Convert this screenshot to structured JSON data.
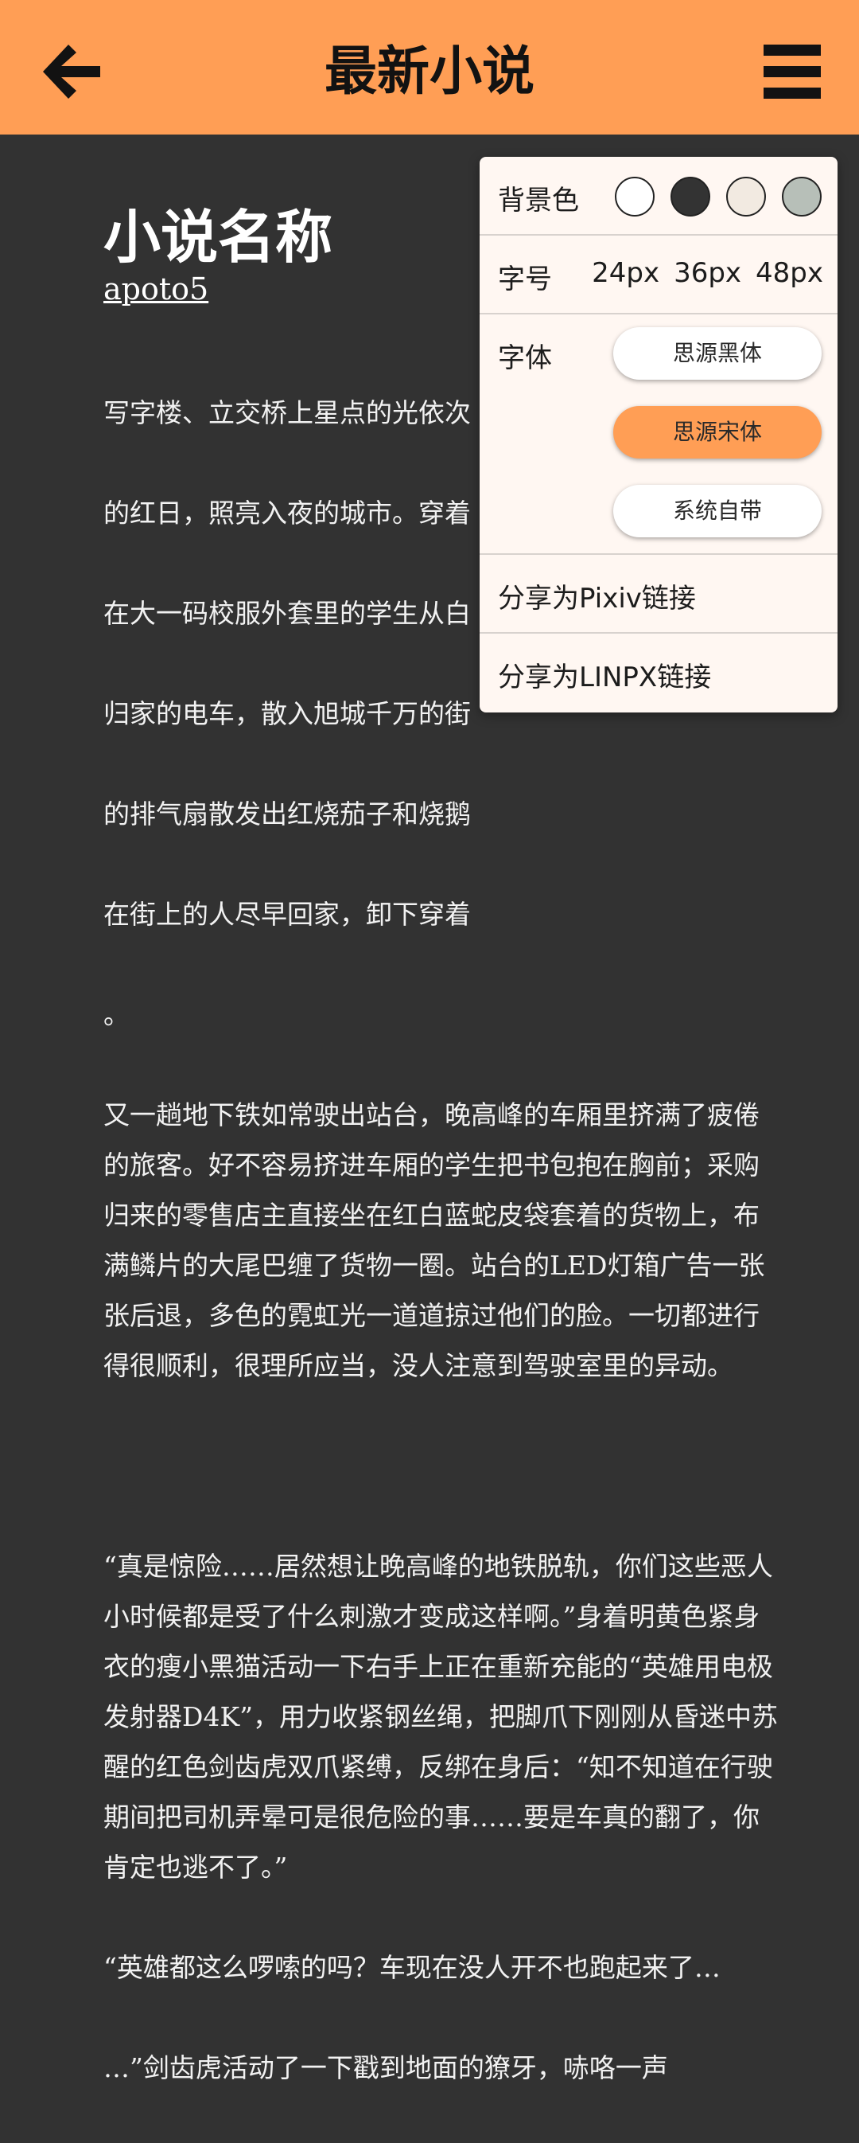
{
  "app_bar": {
    "title": "最新小说",
    "background": "#FF9E55",
    "back_icon": "arrow-left-icon",
    "menu_icon": "hamburger-menu-icon"
  },
  "novel": {
    "title": "小说名称",
    "author": "apoto5",
    "paragraphs": [
      "写字楼、立交桥上星点的光依次",
      "的红日，照亮入夜的城市。穿着",
      "在大一码校服外套里的学生从白",
      "归家的电车，散入旭城千万的街",
      "的排气扇散发出红烧茄子和烧鹅",
      "在街上的人尽早回家，卸下穿着",
      "。",
      "又一趟地下铁如常驶出站台，晚高峰的车厢里挤满了疲倦的旅客。好不容易挤进车厢的学生把书包抱在胸前；采购归来的零售店主直接坐在红白蓝蛇皮袋套着的货物上，布满鳞片的大尾巴缠了货物一圈。站台的LED灯箱广告一张张后退，多色的霓虹光一道道掠过他们的脸。一切都进行得很顺利，很理所应当，没人注意到驾驶室里的异动。",
      "",
      "“真是惊险……居然想让晚高峰的地铁脱轨，你们这些恶人小时候都是受了什么刺激才变成这样啊。”身着明黄色紧身衣的瘦小黑猫活动一下右手上正在重新充能的“英雄用电极发射器D4K”，用力收紧钢丝绳，把脚爪下刚刚从昏迷中苏醒的红色剑齿虎双爪紧缚，反绑在身后：“知不知道在行驶期间把司机弄晕可是很危险的事……要是车真的翻了，你肯定也逃不了。”",
      "“英雄都这么啰嗦的吗？车现在没人开不也跑起来了…",
      "…”剑齿虎活动了一下戳到地面的獠牙，哧咯一声"
    ]
  },
  "settings": {
    "background_label": "背景色",
    "background_colors": [
      "#FFFFFF",
      "#333333",
      "#F2EAE1",
      "#B7BFB8"
    ],
    "font_size_label": "字号",
    "font_sizes": [
      "24px",
      "36px",
      "48px"
    ],
    "font_label": "字体",
    "fonts": [
      "思源黑体",
      "思源宋体",
      "系统自带"
    ],
    "selected_font": "思源宋体",
    "accent": "#FF9E55",
    "share_pixiv": "分享为Pixiv链接",
    "share_linpx": "分享为LINPX链接"
  }
}
